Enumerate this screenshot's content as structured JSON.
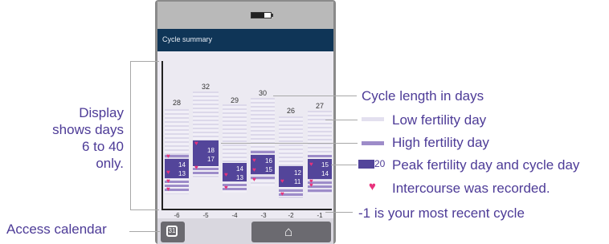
{
  "screen": {
    "title": "Cycle summary",
    "home_button_label": "",
    "calendar_icon_glyph": "31"
  },
  "cycles": [
    {
      "index": "-6",
      "length": "28",
      "peak_days": [
        "14",
        "13"
      ]
    },
    {
      "index": "-5",
      "length": "32",
      "peak_days": [
        "18",
        "17"
      ]
    },
    {
      "index": "-4",
      "length": "29",
      "peak_days": [
        "14",
        "13"
      ]
    },
    {
      "index": "-3",
      "length": "30",
      "peak_days": [
        "16",
        "15"
      ]
    },
    {
      "index": "-2",
      "length": "26",
      "peak_days": [
        "12",
        "11"
      ]
    },
    {
      "index": "-1",
      "length": "27",
      "peak_days": [
        "15",
        "14"
      ]
    }
  ],
  "annotations": {
    "display_range": [
      "Display",
      "shows days",
      "6 to 40 only."
    ],
    "access_calendar": "Access calendar",
    "cycle_length": "Cycle length in days",
    "low_fertility": "Low fertility day",
    "high_fertility": "High fertility day",
    "peak_sample": "20",
    "peak_fertility": "Peak fertility day and cycle day",
    "intercourse": "Intercourse was recorded.",
    "recent_cycle": "-1 is your most recent cycle"
  },
  "colors": {
    "low": "#e3e0ef",
    "high": "#9d8cc9",
    "peak": "#53459a",
    "heart": "#e8327c",
    "annotation_text": "#4d3b97",
    "title_bar": "#0f3557"
  },
  "icons": [
    "battery-icon",
    "calendar-icon",
    "home-icon",
    "heart-icon"
  ]
}
